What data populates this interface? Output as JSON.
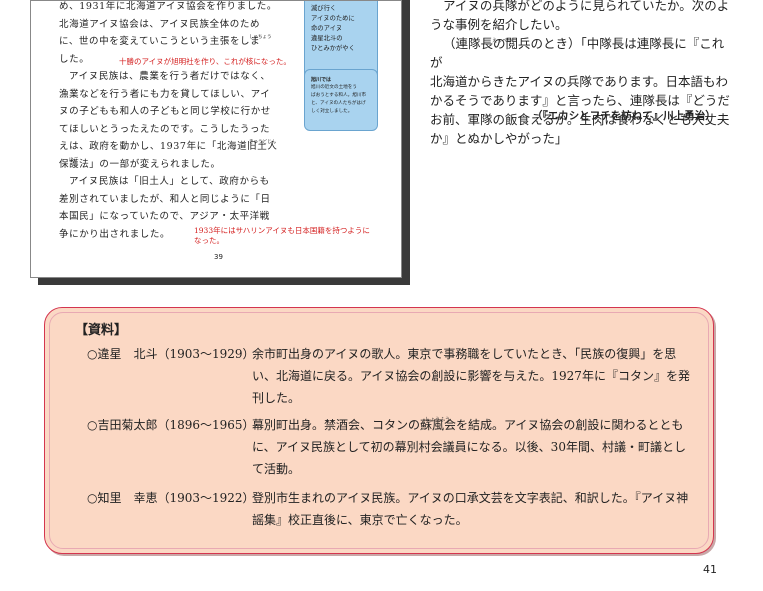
{
  "textbook_page": {
    "lines": [
      "め、1931年に北海道アイヌ協会を作りました。",
      "北海道アイヌ協会は、アイヌ民族全体のため",
      "に、世の中を変えていこうという主張をしま",
      "した。"
    ],
    "note1": "十勝のアイヌが旭明社を作り、これが核になった。",
    "lines2": [
      "アイヌ民族は、農業を行う者だけではなく、",
      "漁業などを行う者にも力を貸してほしい、アイ",
      "ヌの子どもも和人の子どもと同じ学校に行かせ",
      "てほしいとうったえたのです。こうしたうった",
      "えは、政府を動かし、1937年に「北海道旧土人",
      "保護法」の一部が変えられました。",
      "アイヌ民族は「旧土人」として、政府からも",
      "差別されていましたが、和人と同じように「日",
      "本国民」になっていたので、アジア・太平洋戦",
      "争にかり出されました。"
    ],
    "note2": "1933年にはサハリンアイヌも日本国籍を持つように",
    "note2b": "なった。",
    "ruby_shucho": "しゅちょう",
    "ruby_kyudojin": "きゅうどじん",
    "ruby_hogo": "ほご",
    "side_box1": [
      "滅び行く",
      "アイヌのために",
      "命のアイヌ",
      "違星北斗の",
      "ひとみかがやく"
    ],
    "side_box2_title": "旭川では",
    "side_box2_text": [
      "旭川の近文の土地をう",
      "ばおうとする和人。旭川市",
      "と、アイヌの人たちがはげ",
      "しく対立しました。"
    ],
    "page_number": "39"
  },
  "right_text": {
    "lines": [
      "アイヌの兵隊がどのように見られていたか。次のよ",
      "うな事例を紹介したい。",
      "（連隊長の閲兵のとき）「中隊長は連隊長に『これが",
      "北海道からきたアイヌの兵隊であります。日本語もわ",
      "かるそうであります』と言ったら、連隊長は『どうだ",
      "お前、軍隊の飯食えるか。生肉は食わなくとも大丈夫",
      "か』とぬかしやがった」"
    ],
    "ruby_eppei": "えっぺい",
    "citation": "（『エカシとフチを訪ねて』川上勇治）"
  },
  "reference": {
    "title": "【資料】",
    "entries": [
      {
        "name": "○違星　北斗（1903〜1929）",
        "desc": "余市町出身のアイヌの歌人。東京で事務職をしていたとき、「民族の復興」を思い、北海道に戻る。アイヌ協会の創設に影響を与えた。1927年に『コタン』を発刊した。"
      },
      {
        "name": "○吉田菊太郎（1896〜1965）",
        "desc": "幕別町出身。禁酒会、コタンの蘇風会を結成。アイヌ協会の創設に関わるとともに、アイヌ民族として初の幕別村会議員になる。以後、30年間、村議・町議として活動。"
      },
      {
        "name": "○知里　幸恵（1903〜1922）",
        "desc": "登別市生まれのアイヌ民族。アイヌの口承文芸を文字表記、和訳した。『アイヌ神謡集』校正直後に、東京で亡くなった。"
      }
    ],
    "ruby_shofu": "しょうふう"
  },
  "page_number": "41",
  "colors": {
    "reference_bg": "#fbd8c4",
    "reference_border": "#d4354f",
    "side_box_bg": "#a9d3ef",
    "note_red": "#d42020"
  }
}
